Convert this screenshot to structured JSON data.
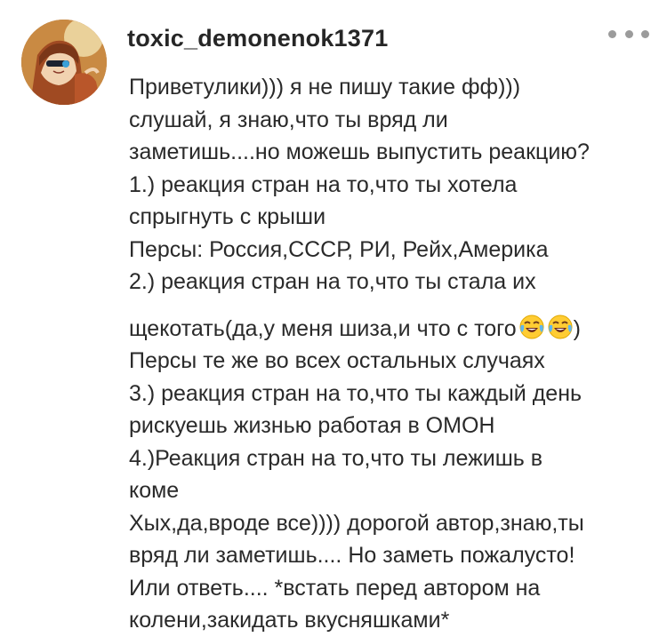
{
  "comment": {
    "username": "toxic_demonenok1371",
    "avatar_icon": "anime-character-avatar-icon",
    "more_icon": "more-options-icon",
    "lines": [
      "Приветулики))) я не пишу такие фф)))",
      "слушай, я знаю,что ты вряд ли",
      "заметишь....но можешь выпустить реакцию?",
      "1.) реакция стран на то,что ты хотела",
      "спрыгнуть с крыши",
      "Персы: Россия,СССР, РИ, Рейх,Америка",
      "2.) реакция стран на то,что ты стала их",
      "щекотать(да,у меня шиза,и что с того",
      ")",
      "Персы те же во всех остальных случаях",
      "3.) реакция стран на то,что ты каждый день",
      "рискуешь жизнью работая в ОМОН",
      "4.)Реакция стран на то,что ты лежишь в",
      "коме",
      "Хых,да,вроде все)))) дорогой автор,знаю,ты",
      "вряд ли заметишь.... Но заметь пожалусто!",
      "Или ответь.... *встать перед автором на",
      "колени,закидать вкусняшками*"
    ],
    "emoji_icon": "tears-of-joy-emoji-icon"
  }
}
